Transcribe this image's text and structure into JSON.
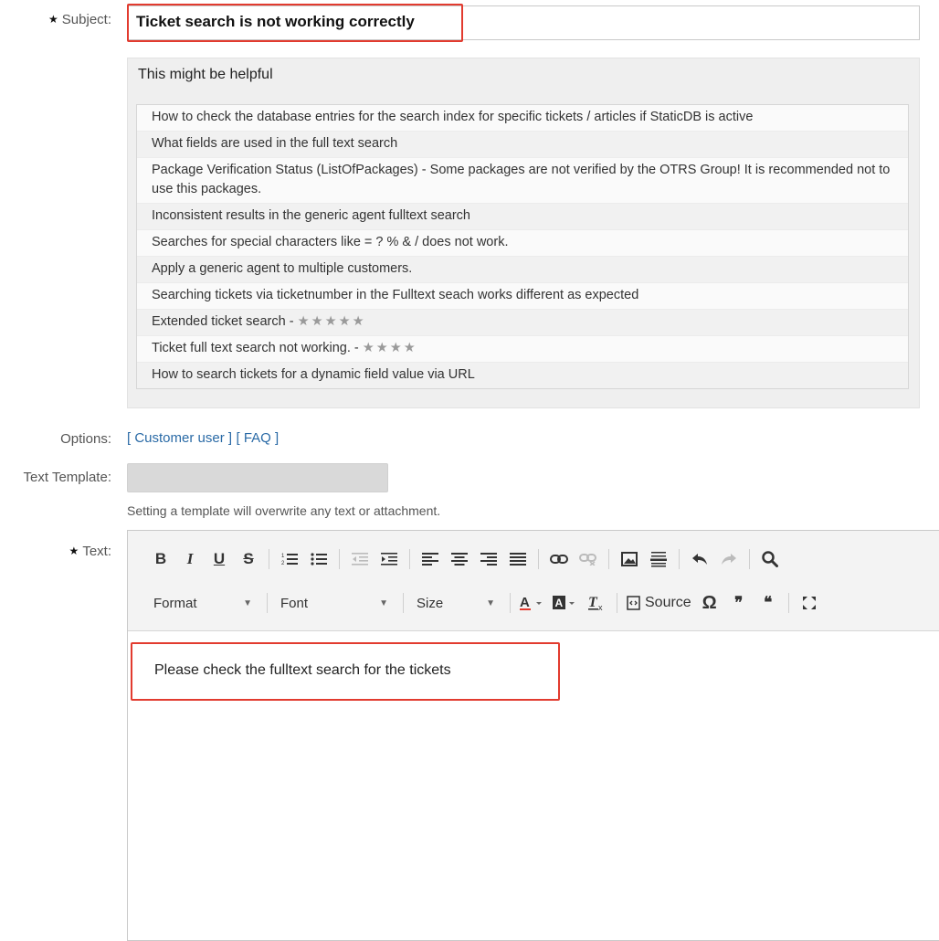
{
  "subject": {
    "label": "Subject:",
    "value": "Ticket search is not working correctly"
  },
  "helpful": {
    "title": "This might be helpful",
    "items": [
      {
        "text": "How to check the database entries for the search index for specific tickets / articles if StaticDB is active",
        "stars": ""
      },
      {
        "text": "What fields are used in the full text search",
        "stars": ""
      },
      {
        "text": "Package Verification Status (ListOfPackages) - Some packages are not verified by the OTRS Group! It is recommended not to use this packages.",
        "stars": ""
      },
      {
        "text": "Inconsistent results in the generic agent fulltext search",
        "stars": ""
      },
      {
        "text": "Searches for special characters like = ? % & / does not work.",
        "stars": ""
      },
      {
        "text": "Apply a generic agent to multiple customers.",
        "stars": ""
      },
      {
        "text": "Searching tickets via ticketnumber in the Fulltext seach works different as expected",
        "stars": ""
      },
      {
        "text": "Extended ticket search - ",
        "stars": "★★★★★"
      },
      {
        "text": "Ticket full text search not working. - ",
        "stars": "★★★★"
      },
      {
        "text": "How to search tickets for a dynamic field value via URL",
        "stars": ""
      }
    ]
  },
  "options": {
    "label": "Options:",
    "link_customer": "[ Customer user ]",
    "link_faq": "[ FAQ ]"
  },
  "template": {
    "label": "Text Template:",
    "hint": "Setting a template will overwrite any text or attachment."
  },
  "text": {
    "label": "Text:",
    "body": "Please check the fulltext search for the tickets"
  },
  "toolbar": {
    "bold": "B",
    "italic": "I",
    "underline": "U",
    "strike": "S",
    "format": "Format",
    "font": "Font",
    "size": "Size",
    "source": "Source"
  },
  "colors": {
    "highlight": "#e23b2f",
    "link": "#2a6aa6"
  }
}
